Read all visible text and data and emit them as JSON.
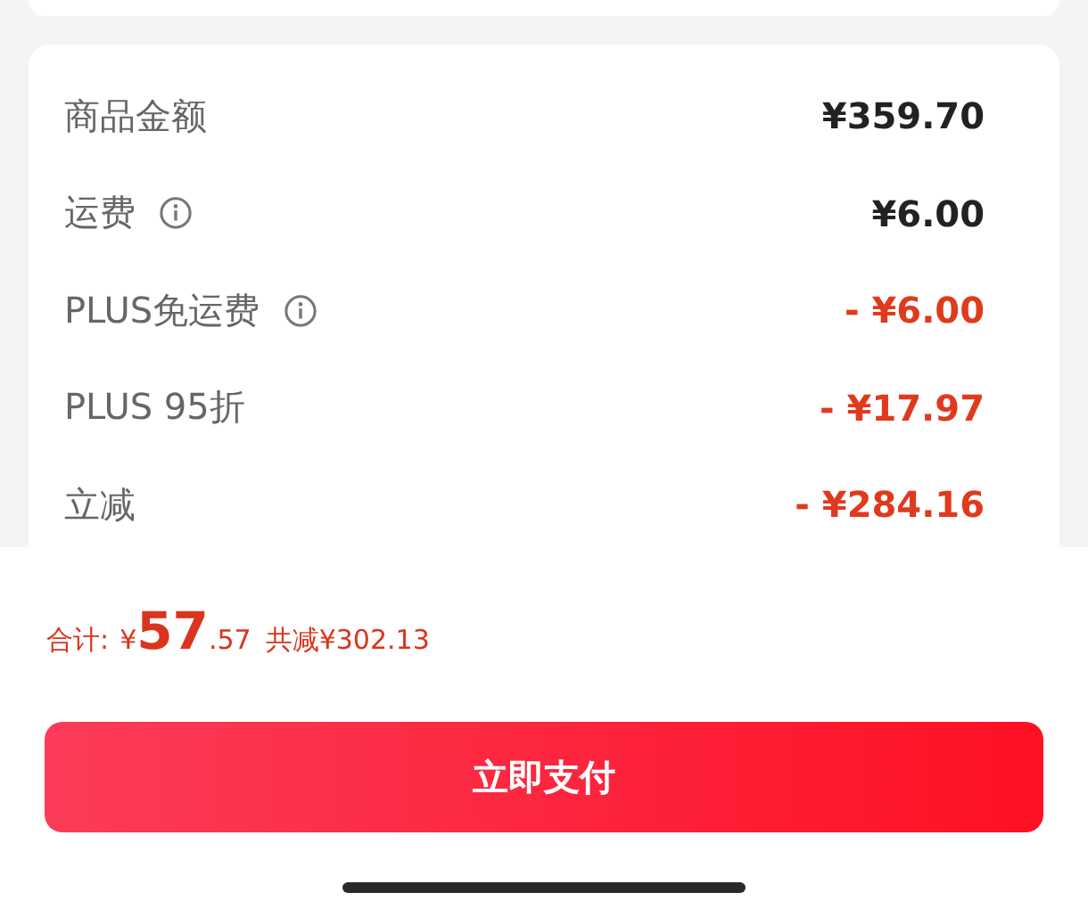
{
  "price_rows": [
    {
      "label": "商品金额",
      "info": false,
      "kind": "charge",
      "amount": "¥359.70"
    },
    {
      "label": "运费",
      "info": true,
      "kind": "charge",
      "amount": "¥6.00"
    },
    {
      "label": "PLUS免运费",
      "info": true,
      "kind": "discount",
      "amount": "- ¥6.00"
    },
    {
      "label": "PLUS 95折",
      "info": false,
      "kind": "discount",
      "amount": "- ¥17.97"
    },
    {
      "label": "立减",
      "info": false,
      "kind": "discount",
      "amount": "- ¥284.16"
    }
  ],
  "total": {
    "label": "合计:",
    "currency": "¥",
    "integer": "57",
    "decimal": ".57",
    "saved": "共减¥302.13"
  },
  "pay_button": "立即支付"
}
